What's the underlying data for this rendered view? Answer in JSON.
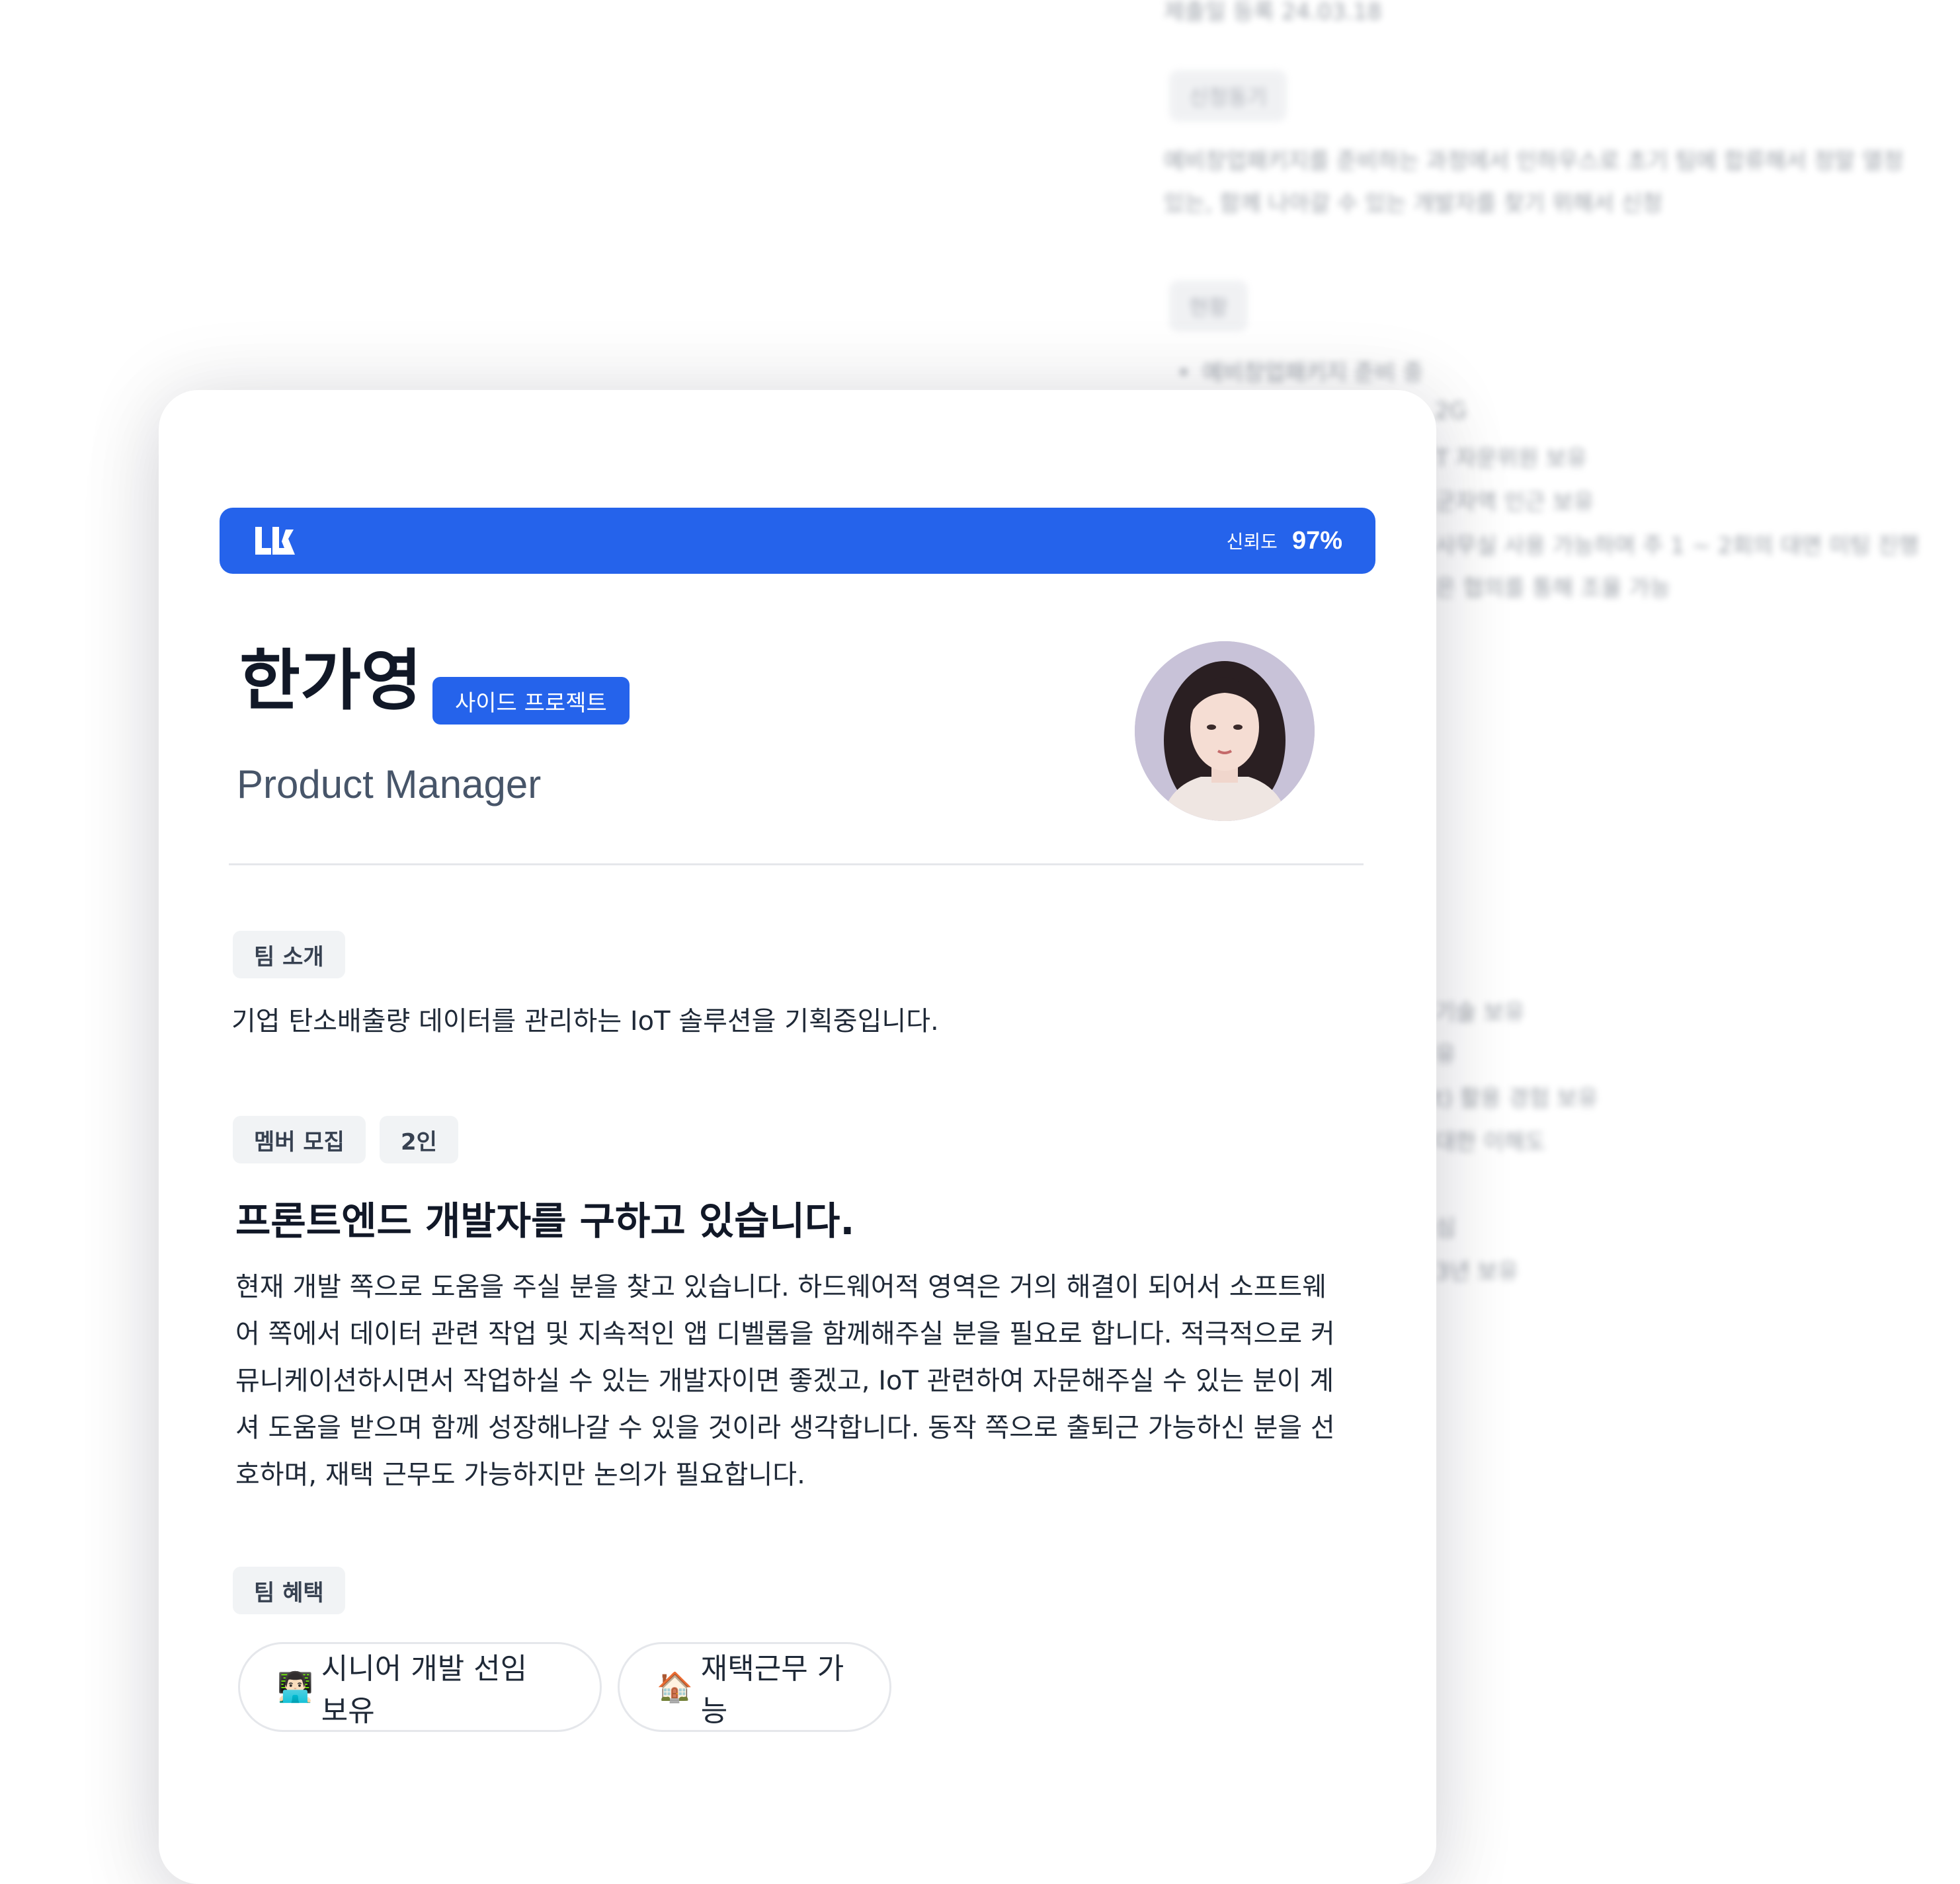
{
  "background_doc": {
    "top_line": "제출일 등록 24.03.18",
    "motivation_label": "신청동기",
    "motivation_text": [
      "예비창업패키지를 준비하는 과정에서 인하우스로 초기 팀에 합류해서 정말 열정",
      "있는, 함께 나아갈 수 있는 개발자를 찾기 위해서 신청"
    ],
    "status_label": "현황",
    "status_items": [
      "예비창업패키지 준비 중",
      "2G",
      "T 자문위원 보유",
      "군자역 인근 보유",
      "사무실 사용 가능하며 주 1 ~ 2회의 대면 미팅 진행",
      "은 협의를 통해 조율 가능"
    ],
    "lower_items": [
      "기술 보유",
      "유",
      "t) 활용 경험 보유",
      "대한 이해도",
      "심",
      "3년 보유"
    ]
  },
  "card": {
    "trust_label": "신뢰도",
    "trust_value": "97%",
    "name": "한가영",
    "project_type": "사이드 프로젝트",
    "role": "Product Manager",
    "team_intro_label": "팀 소개",
    "team_intro_text": "기업 탄소배출량 데이터를 관리하는 IoT 솔루션을 기획중입니다.",
    "recruit_label": "멤버 모집",
    "recruit_count": "2인",
    "recruit_title": "프론트엔드 개발자를 구하고 있습니다.",
    "recruit_desc": [
      "현재 개발 쪽으로 도움을 주실 분을 찾고 있습니다. 하드웨어적 영역은 거의 해결이 되어서 소프트웨",
      "어 쪽에서 데이터 관련 작업 및 지속적인 앱 디벨롭을 함께해주실 분을 필요로 합니다. 적극적으로 커",
      "뮤니케이션하시면서 작업하실 수 있는 개발자이면 좋겠고,  IoT 관련하여 자문해주실 수 있는 분이 계",
      "셔 도움을 받으며 함께 성장해나갈 수 있을 것이라 생각합니다. 동작 쪽으로 출퇴근 가능하신 분을 선",
      "호하며, 재택 근무도 가능하지만 논의가 필요합니다."
    ],
    "benefits_label": "팀 혜택",
    "benefits": [
      {
        "emoji": "👨🏻‍💻",
        "label": "시니어 개발 선임 보유"
      },
      {
        "emoji": "🏠",
        "label": "재택근무 가능"
      }
    ]
  },
  "colors": {
    "accent": "#2563eb",
    "chip_bg": "#f1f3f5",
    "text": "#1f2937",
    "muted": "#475569"
  }
}
